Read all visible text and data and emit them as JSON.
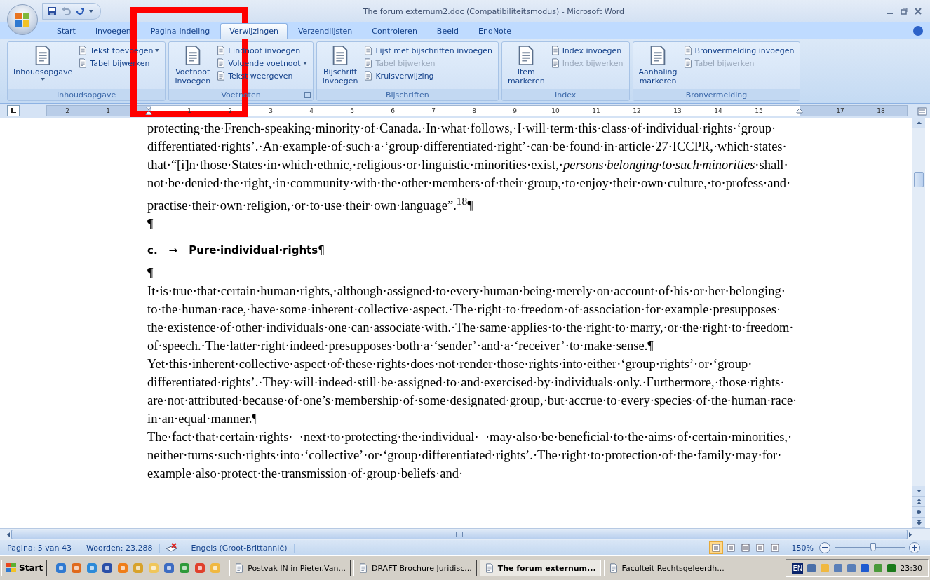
{
  "window": {
    "title": "The forum externum2.doc (Compatibiliteitsmodus) - Microsoft Word"
  },
  "tabs": [
    {
      "label": "Start",
      "selected": false
    },
    {
      "label": "Invoegen",
      "selected": false
    },
    {
      "label": "Pagina-indeling",
      "selected": false
    },
    {
      "label": "Verwijzingen",
      "selected": true
    },
    {
      "label": "Verzendlijsten",
      "selected": false
    },
    {
      "label": "Controleren",
      "selected": false
    },
    {
      "label": "Beeld",
      "selected": false
    },
    {
      "label": "EndNote",
      "selected": false
    }
  ],
  "ribbon": {
    "groups": [
      {
        "label": "Inhoudsopgave",
        "launcher": false,
        "large": {
          "label": "Inhoudsopgave",
          "dropdown": true
        },
        "items": [
          {
            "label": "Tekst toevoegen",
            "dropdown": true,
            "disabled": false
          },
          {
            "label": "Tabel bijwerken",
            "dropdown": false,
            "disabled": false
          }
        ]
      },
      {
        "label": "Voetnoten",
        "launcher": true,
        "large": {
          "label": "Voetnoot invoegen",
          "dropdown": false
        },
        "items": [
          {
            "label": "Eindnoot invoegen",
            "dropdown": false,
            "disabled": false
          },
          {
            "label": "Volgende voetnoot",
            "dropdown": true,
            "disabled": false
          },
          {
            "label": "Tekst weergeven",
            "dropdown": false,
            "disabled": false
          }
        ]
      },
      {
        "label": "Bijschriften",
        "launcher": false,
        "large": {
          "label": "Bijschrift invoegen",
          "dropdown": false
        },
        "items": [
          {
            "label": "Lijst met bijschriften invoegen",
            "dropdown": false,
            "disabled": false
          },
          {
            "label": "Tabel bijwerken",
            "dropdown": false,
            "disabled": true
          },
          {
            "label": "Kruisverwijzing",
            "dropdown": false,
            "disabled": false
          }
        ]
      },
      {
        "label": "Index",
        "launcher": false,
        "large": {
          "label": "Item markeren",
          "dropdown": false
        },
        "items": [
          {
            "label": "Index invoegen",
            "dropdown": false,
            "disabled": false
          },
          {
            "label": "Index bijwerken",
            "dropdown": false,
            "disabled": true
          }
        ]
      },
      {
        "label": "Bronvermelding",
        "launcher": false,
        "large": {
          "label": "Aanhaling markeren",
          "dropdown": false
        },
        "items": [
          {
            "label": "Bronvermelding invoegen",
            "dropdown": false,
            "disabled": false
          },
          {
            "label": "Tabel bijwerken",
            "dropdown": false,
            "disabled": true
          }
        ]
      }
    ]
  },
  "ruler": {
    "marks": [
      {
        "kind": "number",
        "label": "2"
      },
      {
        "kind": "number",
        "label": "1"
      },
      {
        "kind": "indent"
      },
      {
        "kind": "number",
        "label": "1"
      },
      {
        "kind": "number",
        "label": "2"
      },
      {
        "kind": "number",
        "label": "3"
      },
      {
        "kind": "number",
        "label": "4"
      },
      {
        "kind": "number",
        "label": "5"
      },
      {
        "kind": "number",
        "label": "6"
      },
      {
        "kind": "number",
        "label": "7"
      },
      {
        "kind": "number",
        "label": "8"
      },
      {
        "kind": "number",
        "label": "9"
      },
      {
        "kind": "number",
        "label": "10"
      },
      {
        "kind": "number",
        "label": "11"
      },
      {
        "kind": "number",
        "label": "12"
      },
      {
        "kind": "number",
        "label": "13"
      },
      {
        "kind": "number",
        "label": "14"
      },
      {
        "kind": "number",
        "label": "15"
      },
      {
        "kind": "right_indent"
      },
      {
        "kind": "number",
        "label": "17"
      },
      {
        "kind": "number",
        "label": "18"
      }
    ]
  },
  "document": {
    "paragraphs": [
      {
        "kind": "body",
        "text": "protecting·the·French-speaking·minority·of·Canada.·In·what·follows,·I·will·term·this·class·of·individual·rights·‘group·differentiated·rights’.·An·example·of·such·a·‘group·differentiated·right’·can·be·found·in·article·27·ICCPR,·which·states·that·“[i]n·those·States·in·which·ethnic,·religious·or·linguistic·minorities·exist,·*persons·belonging·to·such·minorities*·shall·not·be·denied·the·right,·in·community·with·the·other·members·of·their·group,·to·enjoy·their·own·culture,·to·profess·and·practise·their·own·religion,·or·to·use·their·own·language”.$^{18}$¶"
      },
      {
        "kind": "empty",
        "text": "¶"
      },
      {
        "kind": "heading",
        "number": "c.",
        "tab": "→",
        "text": "Pure·individual·rights¶"
      },
      {
        "kind": "empty",
        "text": "¶"
      },
      {
        "kind": "body",
        "text": "It·is·true·that·certain·human·rights,·although·assigned·to·every·human·being·merely·on·account·of·his·or·her·belonging·to·the·human·race,·have·some·inherent·collective·aspect.·The·right·to·freedom·of·association·for·example·presupposes·the·existence·of·other·individuals·one·can·associate·with.·The·same·applies·to·the·right·to·marry,·or·the·right·to·freedom·of·speech.·The·latter·right·indeed·presupposes·both·a·‘sender’·and·a·‘receiver’·to·make·sense.¶"
      },
      {
        "kind": "body",
        "text": "Yet·this·inherent·collective·aspect·of·these·rights·does·not·render·those·rights·into·either·‘group·rights’·or·‘group·differentiated·rights’.·They·will·indeed·still·be·assigned·to·and·exercised·by·individuals·only.·Furthermore,·those·rights·are·not·attributed·because·of·one’s·membership·of·some·designated·group,·but·accrue·to·every·species·of·the·human·race·in·an·equal·manner.¶"
      },
      {
        "kind": "body",
        "text": "The·fact·that·certain·rights·–·next·to·protecting·the·individual·–·may·also·be·beneficial·to·the·aims·of·certain·minorities,·neither·turns·such·rights·into·‘collective’·or·‘group·differentiated·rights’.·The·right·to·protection·of·the·family·may·for·example·also·protect·the·transmission·of·group·beliefs·and·"
      }
    ]
  },
  "status_bar": {
    "page": "Pagina: 5 van 43",
    "words": "Woorden: 23.288",
    "language": "Engels (Groot-Brittannië)",
    "views": [
      {
        "selected": true
      },
      {
        "selected": false
      },
      {
        "selected": false
      },
      {
        "selected": false
      },
      {
        "selected": false
      }
    ],
    "zoom": {
      "label": "150%",
      "level": 0.55
    }
  },
  "taskbar": {
    "start": "Start",
    "tasks": [
      {
        "label": "Postvak IN in Pieter.Van...",
        "selected": false
      },
      {
        "label": "DRAFT Brochure Juridisc...",
        "selected": false
      },
      {
        "label": "The forum externum...",
        "selected": true
      },
      {
        "label": "Faculteit Rechtsgeleerdh...",
        "selected": false
      }
    ],
    "language": "EN",
    "time": "23:30"
  }
}
